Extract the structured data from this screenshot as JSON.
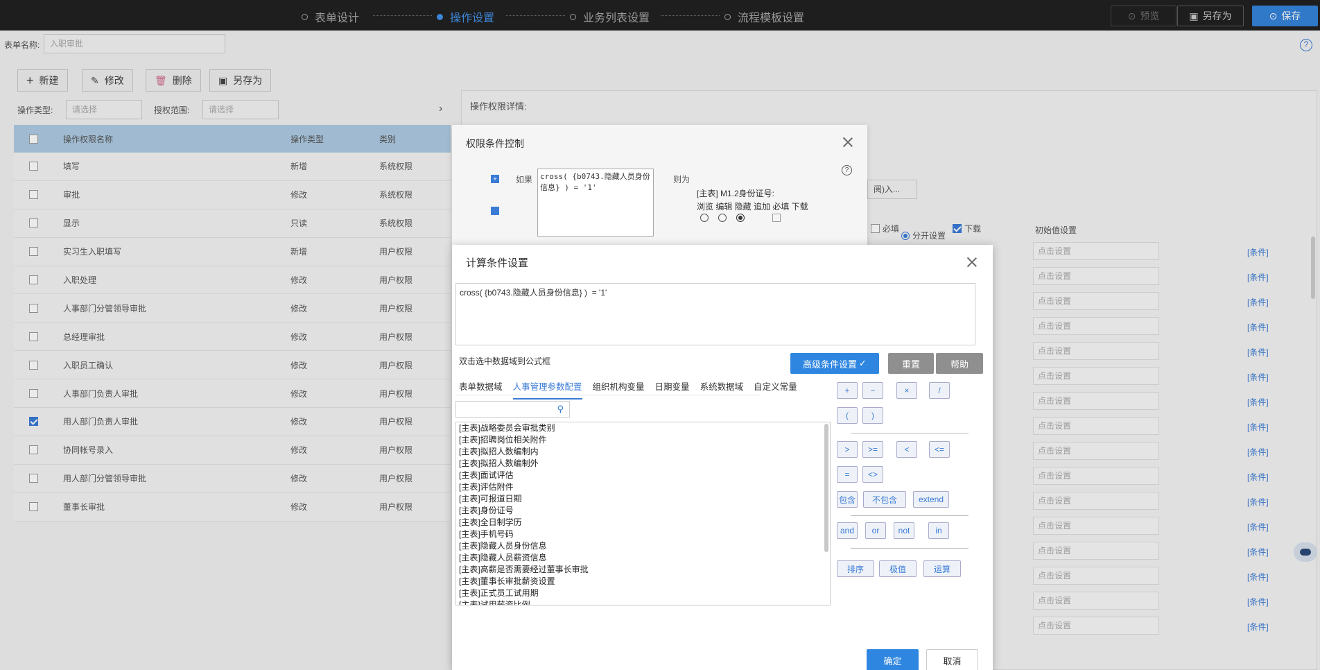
{
  "topbar": {
    "steps": [
      {
        "label": "表单设计",
        "active": false
      },
      {
        "label": "操作设置",
        "active": true
      },
      {
        "label": "业务列表设置",
        "active": false
      },
      {
        "label": "流程模板设置",
        "active": false
      }
    ],
    "preview_label": "预览",
    "save_as_label": "另存为",
    "save_label": "保存"
  },
  "form": {
    "name_label": "表单名称:",
    "name_value": "入职审批"
  },
  "toolbar": {
    "new_label": "新建",
    "edit_label": "修改",
    "delete_label": "删除",
    "save_as_label": "另存为"
  },
  "filters": {
    "op_type_label": "操作类型:",
    "op_type_placeholder": "请选择",
    "scope_label": "授权范围:",
    "scope_placeholder": "请选择"
  },
  "grid": {
    "headers": [
      "操作权限名称",
      "操作类型",
      "类别"
    ],
    "rows": [
      {
        "name": "填写",
        "type": "新增",
        "category": "系统权限",
        "checked": false
      },
      {
        "name": "审批",
        "type": "修改",
        "category": "系统权限",
        "checked": false
      },
      {
        "name": "显示",
        "type": "只读",
        "category": "系统权限",
        "checked": false
      },
      {
        "name": "实习生入职填写",
        "type": "新增",
        "category": "用户权限",
        "checked": false
      },
      {
        "name": "入职处理",
        "type": "修改",
        "category": "用户权限",
        "checked": false
      },
      {
        "name": "人事部门分管领导审批",
        "type": "修改",
        "category": "用户权限",
        "checked": false
      },
      {
        "name": "总经理审批",
        "type": "修改",
        "category": "用户权限",
        "checked": false
      },
      {
        "name": "入职员工确认",
        "type": "修改",
        "category": "用户权限",
        "checked": false
      },
      {
        "name": "人事部门负责人审批",
        "type": "修改",
        "category": "用户权限",
        "checked": false
      },
      {
        "name": "用人部门负责人审批",
        "type": "修改",
        "category": "用户权限",
        "checked": true
      },
      {
        "name": "协同帐号录入",
        "type": "修改",
        "category": "用户权限",
        "checked": false
      },
      {
        "name": "用人部门分管领导审批",
        "type": "修改",
        "category": "用户权限",
        "checked": false
      },
      {
        "name": "董事长审批",
        "type": "修改",
        "category": "用户权限",
        "checked": false
      }
    ]
  },
  "detail": {
    "title": "操作权限详情:",
    "separate_label": "分开设置",
    "select_value": "阅)入...",
    "required_label": "必填",
    "download_label": "下载",
    "init_header": "初始值设置",
    "init_placeholder": "点击设置",
    "cond_label": "[条件]"
  },
  "dialog1": {
    "title": "权限条件控制",
    "if_label": "如果",
    "then_label": "则为",
    "condition": "cross( {b0743.隐藏人员身份信息} )  = '1'",
    "field": "[主表] M1.2身份证号:",
    "perms": "浏览 编辑 隐藏 追加 必填 下载"
  },
  "dialog2": {
    "title": "计算条件设置",
    "formula": "cross( {b0743.隐藏人员身份信息} )  = '1'",
    "hint": "双击选中数据域到公式框",
    "advanced_label": "高级条件设置",
    "reset_label": "重置",
    "help_label": "帮助",
    "tabs": [
      "表单数据域",
      "人事管理参数配置",
      "组织机构变量",
      "日期变量",
      "系统数据域",
      "自定义常量"
    ],
    "active_tab": 1,
    "fields": [
      "[主表]战略委员会审批类别",
      "[主表]招聘岗位相关附件",
      "[主表]拟招人数编制内",
      "[主表]拟招人数编制外",
      "[主表]面试评估",
      "[主表]评估附件",
      "[主表]可报道日期",
      "[主表]身份证号",
      "[主表]全日制学历",
      "[主表]手机号码",
      "[主表]隐藏人员身份信息",
      "[主表]隐藏人员薪资信息",
      "[主表]高薪是否需要经过董事长审批",
      "[主表]董事长审批薪资设置",
      "[主表]正式员工试用期",
      "[主表]试用薪资比例"
    ],
    "ops_row1": [
      "+",
      "−",
      "×",
      "/"
    ],
    "ops_row2": [
      "(",
      ")"
    ],
    "ops_row3": [
      ">",
      ">=",
      "<",
      "<="
    ],
    "ops_row4": [
      "=",
      "<>"
    ],
    "ops_row5": [
      "包含",
      "不包含",
      "extend"
    ],
    "ops_row6": [
      "and",
      "or",
      "not",
      "in"
    ],
    "ops_row7": [
      "排序",
      "极值",
      "运算"
    ],
    "ok_label": "确定",
    "cancel_label": "取消"
  }
}
